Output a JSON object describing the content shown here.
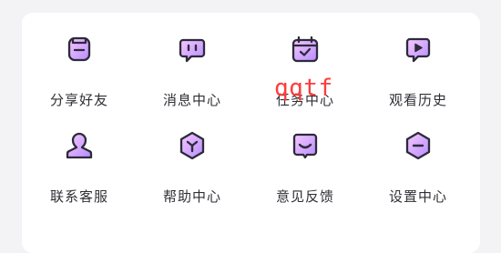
{
  "items": [
    {
      "label": "分享好友",
      "icon": "share-friend-icon"
    },
    {
      "label": "消息中心",
      "icon": "message-center-icon"
    },
    {
      "label": "任务中心",
      "icon": "task-center-icon"
    },
    {
      "label": "观看历史",
      "icon": "watch-history-icon"
    },
    {
      "label": "联系客服",
      "icon": "customer-service-icon"
    },
    {
      "label": "帮助中心",
      "icon": "help-center-icon"
    },
    {
      "label": "意见反馈",
      "icon": "feedback-icon"
    },
    {
      "label": "设置中心",
      "icon": "settings-center-icon"
    }
  ],
  "watermark": "qqtf",
  "colors": {
    "icon_stroke": "#2d2b3a",
    "icon_fill_start": "#f3c3ff",
    "icon_fill_end": "#b78cff",
    "label": "#2f2f35",
    "watermark": "#ff3b3b"
  }
}
